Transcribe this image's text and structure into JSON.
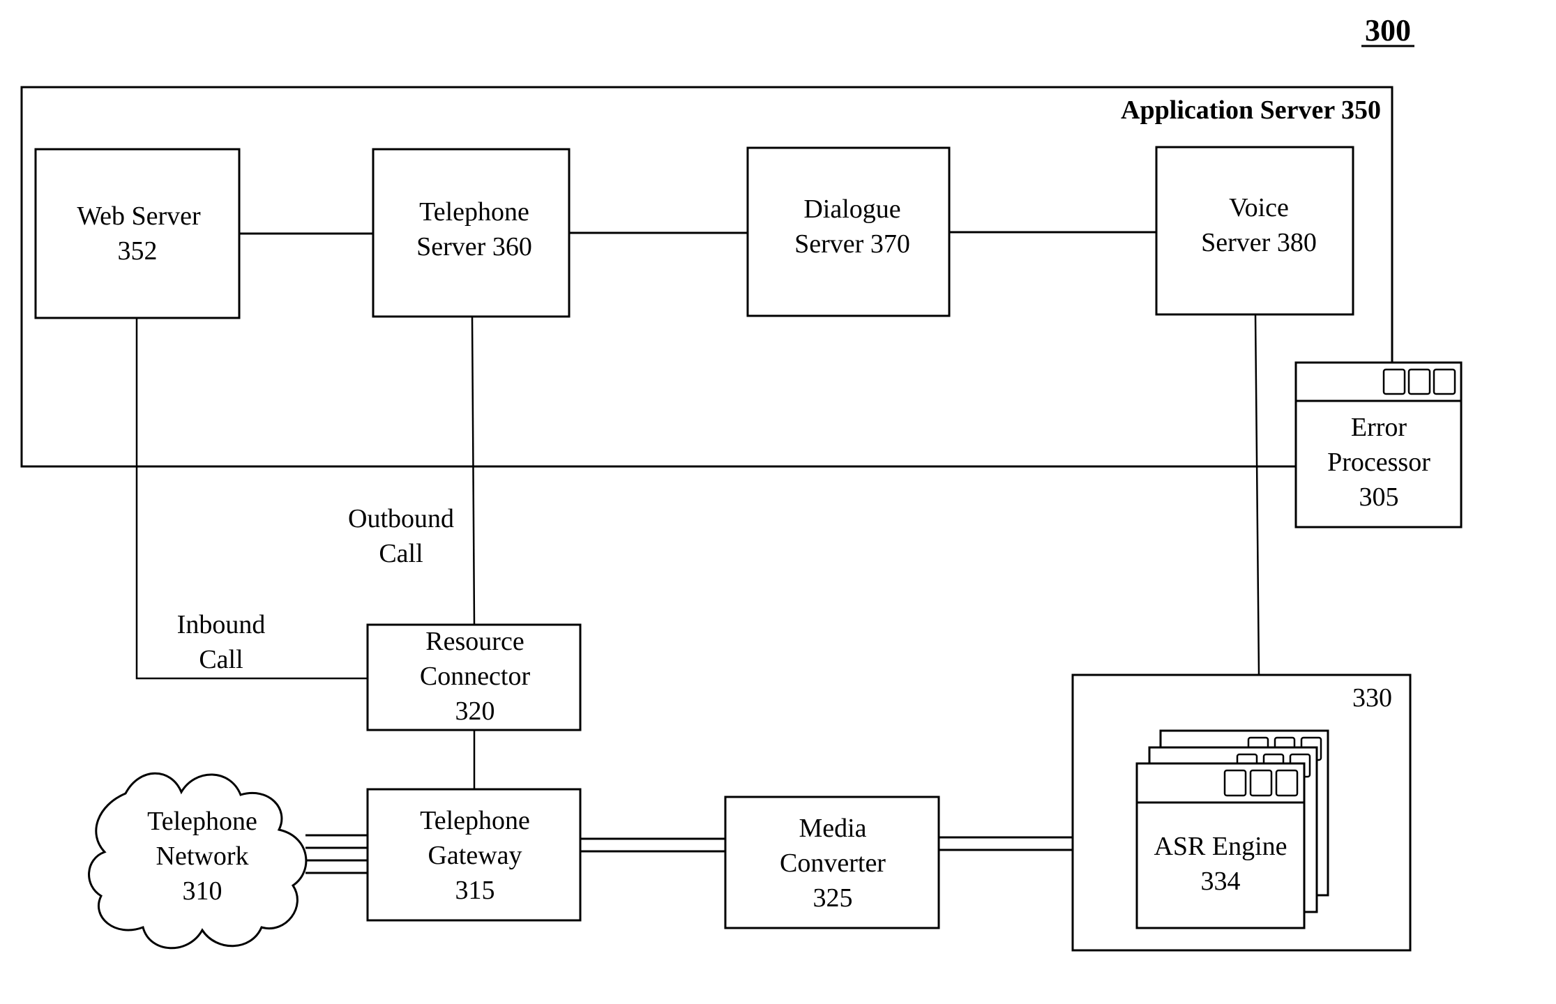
{
  "figure": {
    "number": "300",
    "title_underlined": true
  },
  "application_server": {
    "label": "Application Server 350"
  },
  "nodes": {
    "web_server": {
      "lines": [
        "Web Server",
        "352"
      ]
    },
    "telephone_server": {
      "lines": [
        "Telephone",
        "Server 360"
      ]
    },
    "dialogue_server": {
      "lines": [
        "Dialogue",
        "Server 370"
      ]
    },
    "voice_server": {
      "lines": [
        "Voice",
        "Server 380"
      ]
    },
    "error_processor": {
      "lines": [
        "Error",
        "Processor",
        "305"
      ]
    },
    "resource_connector": {
      "lines": [
        "Resource",
        "Connector",
        "320"
      ]
    },
    "telephone_gateway": {
      "lines": [
        "Telephone",
        "Gateway",
        "315"
      ]
    },
    "telephone_network": {
      "lines": [
        "Telephone",
        "Network",
        "310"
      ]
    },
    "media_converter": {
      "lines": [
        "Media",
        "Converter",
        "325"
      ]
    },
    "asr_group": {
      "label": "330"
    },
    "asr_engine": {
      "lines": [
        "ASR Engine",
        "334"
      ]
    }
  },
  "edge_labels": {
    "outbound_call": [
      "Outbound",
      "Call"
    ],
    "inbound_call": [
      "Inbound",
      "Call"
    ]
  },
  "edges": [
    {
      "from": "web_server",
      "to": "telephone_server",
      "style": "single"
    },
    {
      "from": "telephone_server",
      "to": "dialogue_server",
      "style": "single"
    },
    {
      "from": "dialogue_server",
      "to": "voice_server",
      "style": "single"
    },
    {
      "from": "application_server",
      "to": "error_processor",
      "style": "single"
    },
    {
      "from": "web_server",
      "to": "resource_connector",
      "style": "single",
      "label": "Inbound Call"
    },
    {
      "from": "telephone_server",
      "to": "resource_connector",
      "style": "single",
      "label": "Outbound Call"
    },
    {
      "from": "resource_connector",
      "to": "telephone_gateway",
      "style": "single"
    },
    {
      "from": "telephone_network",
      "to": "telephone_gateway",
      "style": "quad"
    },
    {
      "from": "telephone_gateway",
      "to": "media_converter",
      "style": "double"
    },
    {
      "from": "media_converter",
      "to": "asr_group",
      "style": "double"
    },
    {
      "from": "voice_server",
      "to": "asr_group",
      "style": "single"
    }
  ]
}
